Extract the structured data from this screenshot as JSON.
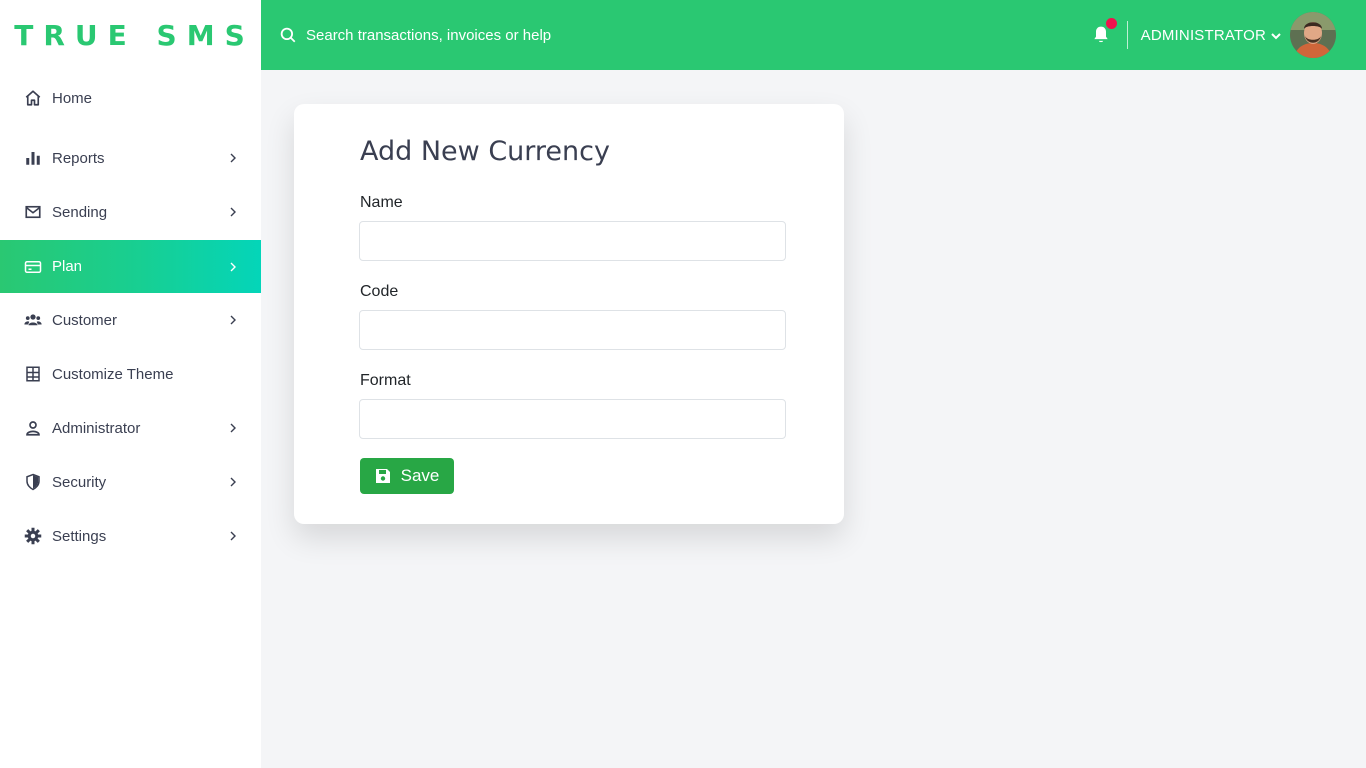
{
  "brand": {
    "name": "TRUE SMS"
  },
  "search": {
    "placeholder": "Search transactions, invoices or help"
  },
  "user": {
    "name": "ADMINISTRATOR",
    "has_notification": true
  },
  "colors": {
    "accent": "#2ac872",
    "active_gradient_end": "#04d5b9",
    "save_button": "#28a745",
    "notification_dot": "#f0134d"
  },
  "sidebar": {
    "items": [
      {
        "label": "Home",
        "icon": "home-icon",
        "has_submenu": false,
        "active": false
      },
      {
        "label": "Reports",
        "icon": "bar-chart-icon",
        "has_submenu": true,
        "active": false
      },
      {
        "label": "Sending",
        "icon": "envelope-icon",
        "has_submenu": true,
        "active": false
      },
      {
        "label": "Plan",
        "icon": "credit-card-icon",
        "has_submenu": true,
        "active": true
      },
      {
        "label": "Customer",
        "icon": "users-icon",
        "has_submenu": true,
        "active": false
      },
      {
        "label": "Customize Theme",
        "icon": "grid-icon",
        "has_submenu": false,
        "active": false
      },
      {
        "label": "Administrator",
        "icon": "user-icon",
        "has_submenu": true,
        "active": false
      },
      {
        "label": "Security",
        "icon": "shield-icon",
        "has_submenu": true,
        "active": false
      },
      {
        "label": "Settings",
        "icon": "gear-icon",
        "has_submenu": true,
        "active": false
      }
    ]
  },
  "form": {
    "title": "Add New Currency",
    "fields": [
      {
        "label": "Name",
        "value": "",
        "placeholder": ""
      },
      {
        "label": "Code",
        "value": "",
        "placeholder": ""
      },
      {
        "label": "Format",
        "value": "",
        "placeholder": ""
      }
    ],
    "save_label": "Save"
  }
}
